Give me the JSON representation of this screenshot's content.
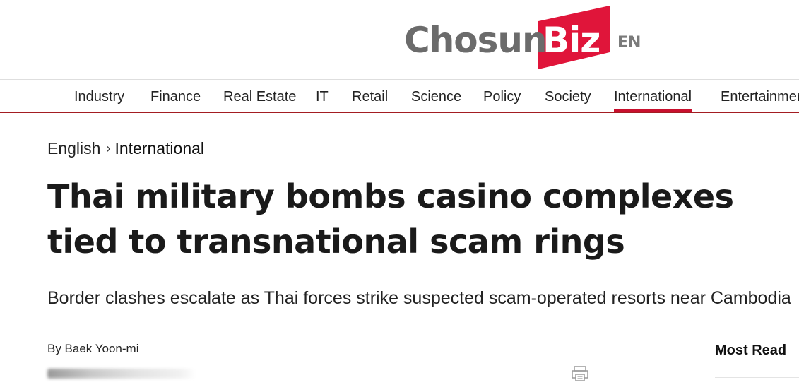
{
  "header": {
    "logo_main": "Chosun",
    "logo_accent": "Biz",
    "logo_lang": "EN",
    "colors": {
      "logo_gray": "#6b6b6b",
      "logo_red": "#e0153a"
    }
  },
  "nav": {
    "items": [
      {
        "label": "Industry"
      },
      {
        "label": "Finance"
      },
      {
        "label": "Real Estate"
      },
      {
        "label": "IT"
      },
      {
        "label": "Retail"
      },
      {
        "label": "Science"
      },
      {
        "label": "Policy"
      },
      {
        "label": "Society"
      },
      {
        "label": "International"
      },
      {
        "label": "Entertainment"
      }
    ],
    "active": "International",
    "accent_color": "#a31d22"
  },
  "breadcrumb": {
    "root": "English",
    "separator": "›",
    "current": "International"
  },
  "article": {
    "title": "Thai military bombs casino complexes tied to transnational scam rings",
    "subtitle": "Border clashes escalate as Thai forces strike suspected scam-operated resorts near Cambodia",
    "byline": "By Baek Yoon-mi"
  },
  "sidebar": {
    "most_read_title": "Most Read"
  },
  "icons": {
    "print": "print-icon",
    "breadcrumb_separator": "chevron-right-icon"
  }
}
